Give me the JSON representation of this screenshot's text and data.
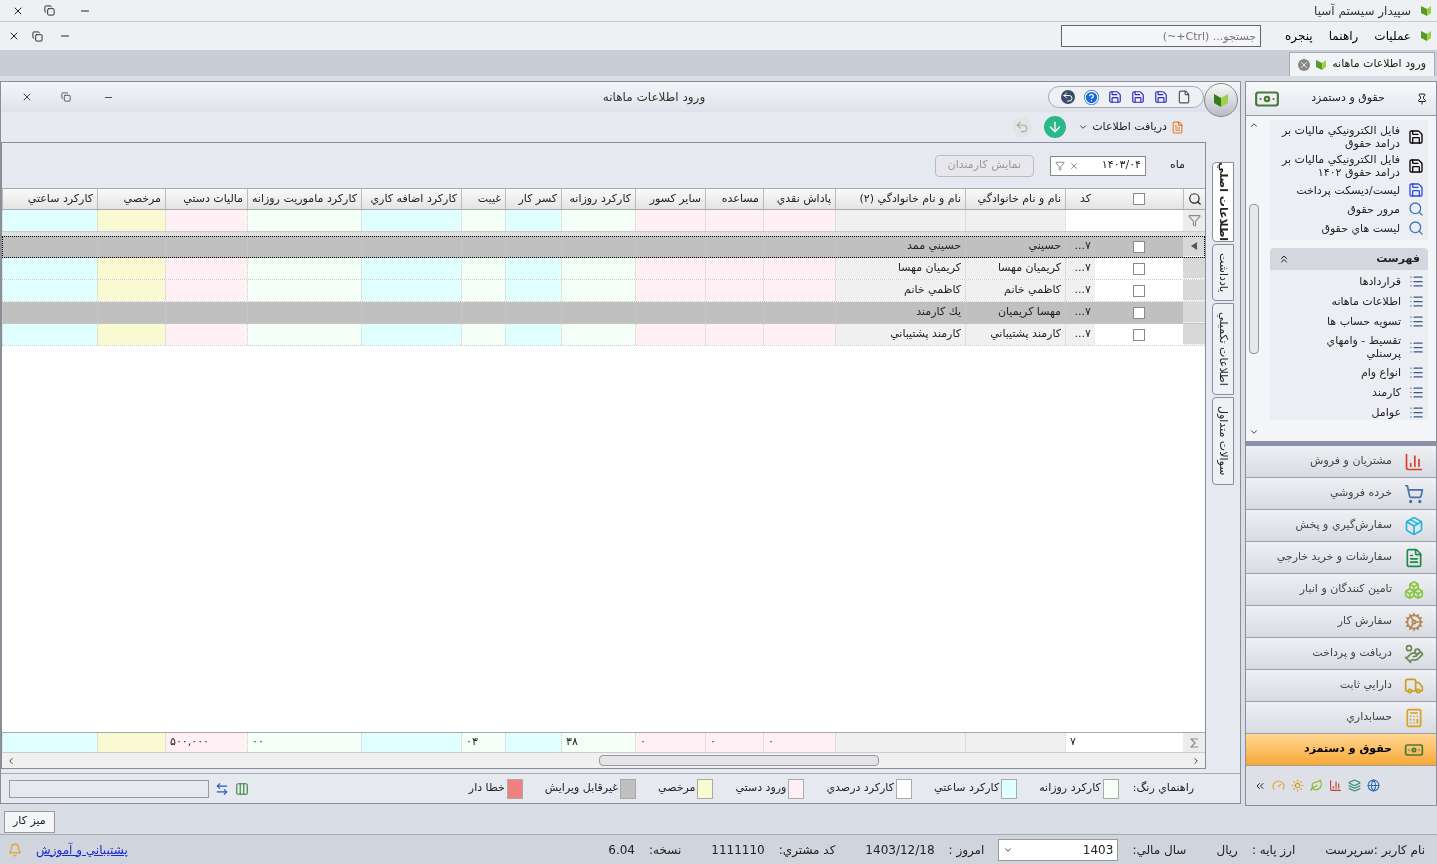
{
  "app": {
    "title": "سپيدار سيستم آسيا"
  },
  "menu": {
    "items": [
      "عمليات",
      "راهنما",
      "پنجره"
    ],
    "search": {
      "placeholder": "جستجو... (Ctrl+~)"
    }
  },
  "document_tab": {
    "label": "ورود اطلاعات ماهانه"
  },
  "window": {
    "title": "ورود اطلاعات ماهانه",
    "fetch_button": "دريافت اطلاعات",
    "filter": {
      "label": "ماه",
      "value": "۱۴۰۳/۰۴",
      "show_button": {
        "label": "نمايش كارمندان",
        "disabled": true
      }
    },
    "side_tabs": [
      {
        "label": "اطلاعات اصلي",
        "selected": true
      },
      {
        "label": "يادداشت",
        "selected": false
      },
      {
        "label": "اطلاعات تكميلي",
        "selected": false
      },
      {
        "label": "سوالات متداول",
        "selected": false
      }
    ],
    "table": {
      "header_checked": false,
      "columns": [
        {
          "label": "كد",
          "color": "#ffffff",
          "total": "۷"
        },
        {
          "label": "نام و نام خانوادگي",
          "color": "#f0f0f0"
        },
        {
          "label": "نام و نام خانوادگي (۲)",
          "color": "#f0f0f0"
        },
        {
          "label": "پاداش نقدي",
          "color": "#fff0f5",
          "total": "۰"
        },
        {
          "label": "مساعده",
          "color": "#fff0f5",
          "total": "۰"
        },
        {
          "label": "ساير كسور",
          "color": "#fff0f5",
          "total": "۰"
        },
        {
          "label": "كاركرد روزانه",
          "color": "#f4fff8",
          "total": "۳۸"
        },
        {
          "label": "كسر كار",
          "color": "#e0ffff"
        },
        {
          "label": "غيبت",
          "color": "#f4fff8",
          "total": "۰۳"
        },
        {
          "label": "كاركرد اضافه كاري",
          "color": "#e0ffff"
        },
        {
          "label": "كاركرد ماموريت روزانه",
          "color": "#f4fff8",
          "total": "۰۰"
        },
        {
          "label": "ماليات دستي",
          "color": "#fff0f5",
          "total": "۵۰۰,۰۰۰"
        },
        {
          "label": "مرخصي",
          "color": "#fafad2"
        },
        {
          "label": "كاركرد ساعتي",
          "color": "#e0ffff"
        }
      ],
      "rows": [
        {
          "checked": false,
          "selected": true,
          "focused": true,
          "code": "۷...",
          "name": "حسيني",
          "name_2": "حسيني ممد"
        },
        {
          "checked": false,
          "selected": false,
          "focused": false,
          "code": "۷...",
          "name": "كريميان مهسا",
          "name_2": "كريميان مهسا"
        },
        {
          "checked": false,
          "selected": false,
          "focused": false,
          "code": "۷...",
          "name": "كاظمي خانم",
          "name_2": "كاظمي خانم"
        },
        {
          "checked": false,
          "selected": true,
          "focused": false,
          "code": "۷...",
          "name": "مهسا كريميان",
          "name_2": "يك كارمند"
        },
        {
          "checked": false,
          "selected": false,
          "focused": false,
          "code": "۷...",
          "name": "كارمند پشتيباني",
          "name_2": "كارمند پشتيباني"
        }
      ]
    },
    "legend": {
      "label": "راهنماي رنگ:",
      "items": [
        {
          "label": "كاركرد روزانه",
          "color": "#f4fff8"
        },
        {
          "label": "كاركرد ساعتي",
          "color": "#e0ffff"
        },
        {
          "label": "كاركرد درصدي",
          "color": "#ffffff"
        },
        {
          "label": "ورود دستي",
          "color": "#fff0f5"
        },
        {
          "label": "مرخصي",
          "color": "#fafad2"
        },
        {
          "label": "غيرقابل ويرايش",
          "color": "#c0c0c0"
        },
        {
          "label": "خطا دار",
          "color": "#f08080"
        }
      ]
    }
  },
  "sidebar": {
    "title": "حقوق و دستمزد",
    "actions": [
      {
        "label": "فايل الكترونيكي ماليات بر درامد حقوق",
        "kind": "disk"
      },
      {
        "label": "فايل الكترونيكي ماليات بر درامد حقوق ۱۴۰۲",
        "kind": "disk"
      },
      {
        "label": "ليست/ديسكت پرداخت",
        "kind": "disk-blue"
      },
      {
        "label": "مرور حقوق",
        "kind": "magnifier"
      },
      {
        "label": "ليست هاي حقوق",
        "kind": "magnifier"
      }
    ],
    "list_title": "فهرست",
    "list": [
      "قراردادها",
      "اطلاعات ماهانه",
      "تسويه حساب ها",
      "تقسيط - وامهاي پرسنلي",
      "انواع وام",
      "كارمند",
      "عوامل"
    ],
    "modules": [
      {
        "label": "مشتريان و فروش",
        "selected": false
      },
      {
        "label": "خرده فروشي",
        "selected": false
      },
      {
        "label": "سفارش‌گيري و پخش",
        "selected": false
      },
      {
        "label": "سفارشات و خريد خارجي",
        "selected": false
      },
      {
        "label": "تامين كنندگان و انبار",
        "selected": false
      },
      {
        "label": "سفارش كار",
        "selected": false
      },
      {
        "label": "دريافت و پرداخت",
        "selected": false
      },
      {
        "label": "دارايي ثابت",
        "selected": false
      },
      {
        "label": "حسابداري",
        "selected": false
      },
      {
        "label": "حقوق و دستمزد",
        "selected": true
      }
    ]
  },
  "desk_button": "ميز كار",
  "status_bar": {
    "user": "نام كاربر :سرپرست",
    "currency_label": "ارز پايه :",
    "currency": "ريال",
    "year_label": "سال مالي:",
    "year": "1403",
    "today_label": "امروز :",
    "today": "1403/12/18",
    "customer_label": "كد مشتري:",
    "customer": "1111110",
    "version_label": "نسخه:",
    "version": "6.04",
    "support_link": "پشتيباني و آموزش"
  }
}
